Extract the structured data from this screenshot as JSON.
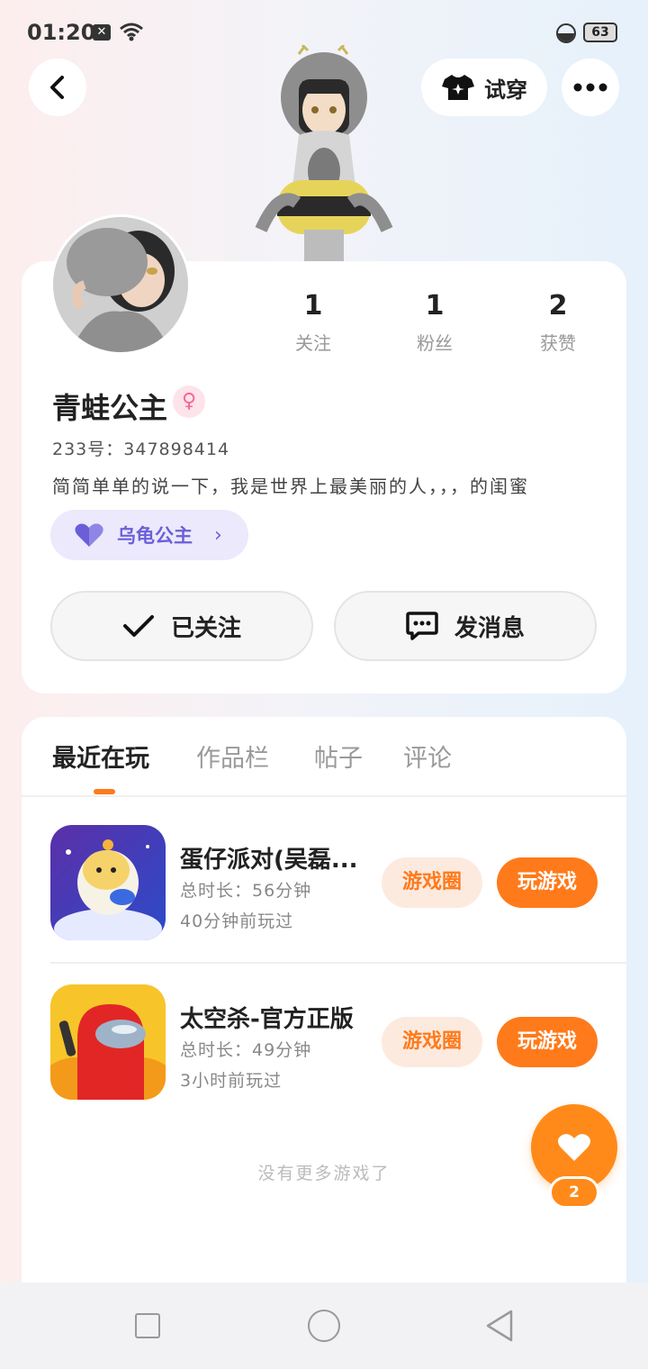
{
  "status_bar": {
    "time": "01:20",
    "battery": "63"
  },
  "header": {
    "try_on_label": "试穿"
  },
  "profile": {
    "stats": [
      {
        "value": "1",
        "label": "关注"
      },
      {
        "value": "1",
        "label": "粉丝"
      },
      {
        "value": "2",
        "label": "获赞"
      }
    ],
    "name": "青蛙公主",
    "gender_symbol": "♀",
    "uid": "233号：347898414",
    "bio": "简简单单的说一下，我是世界上最美丽的人，，，的闺蜜",
    "cp_tag": "乌龟公主",
    "follow_label": "已关注",
    "message_label": "发消息"
  },
  "tabs": [
    "最近在玩",
    "作品栏",
    "帖子",
    "评论"
  ],
  "games": [
    {
      "title": "蛋仔派对(吴磊...",
      "duration": "总时长：56分钟",
      "last_played": "40分钟前玩过",
      "circle_label": "游戏圈",
      "play_label": "玩游戏"
    },
    {
      "title": "太空杀-官方正版",
      "duration": "总时长：49分钟",
      "last_played": "3小时前玩过",
      "circle_label": "游戏圈",
      "play_label": "玩游戏"
    }
  ],
  "no_more_text": "没有更多游戏了",
  "like_count": "2",
  "colors": {
    "accent": "#ff7a1a",
    "cp_purple": "#6b5fd8",
    "gender_pink": "#f3679a"
  },
  "icons": [
    "back-icon",
    "shirt-icon",
    "more-icon",
    "check-icon",
    "chat-icon",
    "heart-icon"
  ]
}
